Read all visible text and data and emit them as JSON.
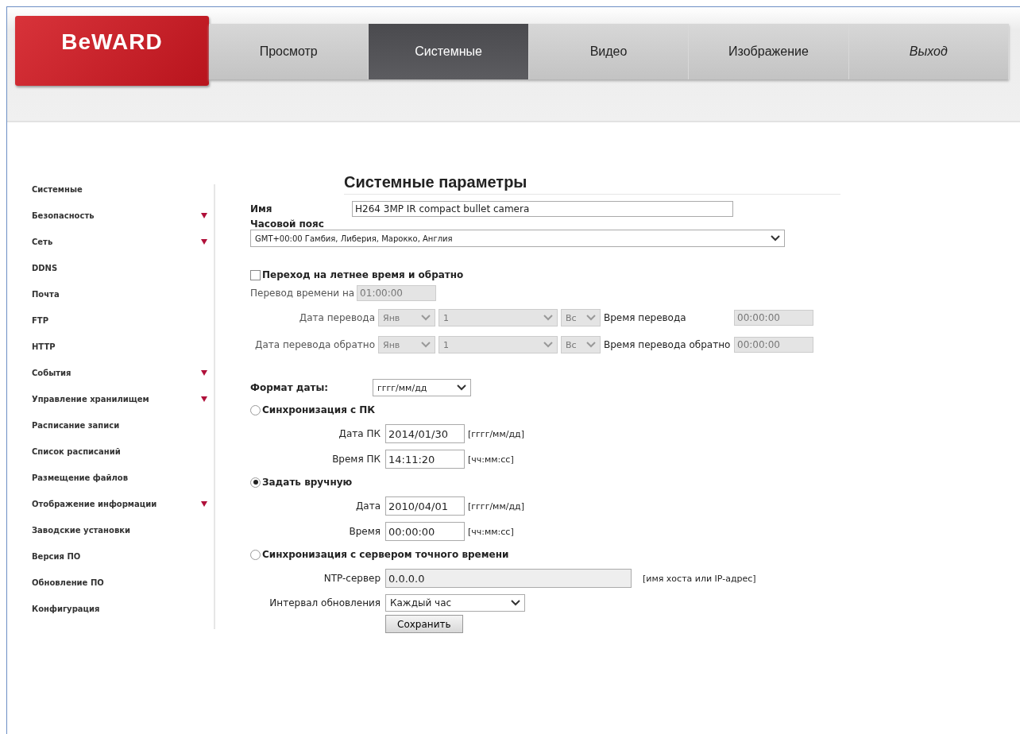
{
  "header": {
    "logo": "BeWARD",
    "tabs": [
      {
        "label": "Просмотр",
        "selected": false,
        "kind": "tab"
      },
      {
        "label": "Системные",
        "selected": true,
        "kind": "tab"
      },
      {
        "label": "Видео",
        "selected": false,
        "kind": "tab"
      },
      {
        "label": "Изображение",
        "selected": false,
        "kind": "tab"
      },
      {
        "label": "Выход",
        "selected": false,
        "kind": "logout"
      }
    ]
  },
  "sidebar": {
    "items": [
      {
        "label": "Системные",
        "expandable": false
      },
      {
        "label": "Безопасность",
        "expandable": true
      },
      {
        "label": "Сеть",
        "expandable": true
      },
      {
        "label": "DDNS",
        "expandable": false
      },
      {
        "label": "Почта",
        "expandable": false
      },
      {
        "label": "FTP",
        "expandable": false
      },
      {
        "label": "HTTP",
        "expandable": false
      },
      {
        "label": "События",
        "expandable": true
      },
      {
        "label": "Управление хранилищем",
        "expandable": true
      },
      {
        "label": "Расписание записи",
        "expandable": false
      },
      {
        "label": "Список расписаний",
        "expandable": false
      },
      {
        "label": "Размещение файлов",
        "expandable": false
      },
      {
        "label": "Отображение информации",
        "expandable": true
      },
      {
        "label": "Заводские установки",
        "expandable": false
      },
      {
        "label": "Версия ПО",
        "expandable": false
      },
      {
        "label": "Обновление ПО",
        "expandable": false
      },
      {
        "label": "Конфигурация",
        "expandable": false
      }
    ]
  },
  "form": {
    "title": "Системные параметры",
    "name": {
      "label": "Имя",
      "value": "H264 3MP IR compact bullet camera"
    },
    "timezone": {
      "label": "Часовой пояс",
      "value": "GMT+00:00 Гамбия, Либерия, Марокко, Англия"
    },
    "dst": {
      "label": "Переход на летнее время и обратно",
      "checked": false,
      "disabled": true,
      "shift": {
        "label": "Перевод времени на",
        "value": "01:00:00"
      },
      "rows": [
        {
          "label": "Дата перевода",
          "month": "Янв",
          "day": "1",
          "weekday": "Вс",
          "time_label": "Время перевода",
          "time": "00:00:00"
        },
        {
          "label": "Дата перевода обратно",
          "month": "Янв",
          "day": "1",
          "weekday": "Вс",
          "time_label": "Время перевода обратно",
          "time": "00:00:00"
        }
      ]
    },
    "date_format": {
      "label": "Формат даты:",
      "value": "гггг/мм/дд"
    },
    "sync_options": [
      {
        "label": "Синхронизация с ПК",
        "selected": false,
        "fields": [
          {
            "label": "Дата ПК",
            "value": "2014/01/30",
            "hint": "[гггг/мм/дд]"
          },
          {
            "label": "Время ПК",
            "value": "14:11:20",
            "hint": "[чч:мм:сс]"
          }
        ]
      },
      {
        "label": "Задать вручную",
        "selected": true,
        "fields": [
          {
            "label": "Дата",
            "value": "2010/04/01",
            "hint": "[гггг/мм/дд]"
          },
          {
            "label": "Время",
            "value": "00:00:00",
            "hint": "[чч:мм:сс]"
          }
        ]
      },
      {
        "label": "Синхронизация с сервером точного времени",
        "selected": false,
        "fields": [
          {
            "label": "NTP-сервер",
            "value": "0.0.0.0",
            "hint": "[имя хоста или IP-адрес]",
            "kind": "wide"
          }
        ]
      }
    ],
    "interval": {
      "label": "Интервал обновления",
      "value": "Каждый час"
    },
    "save": "Сохранить"
  }
}
